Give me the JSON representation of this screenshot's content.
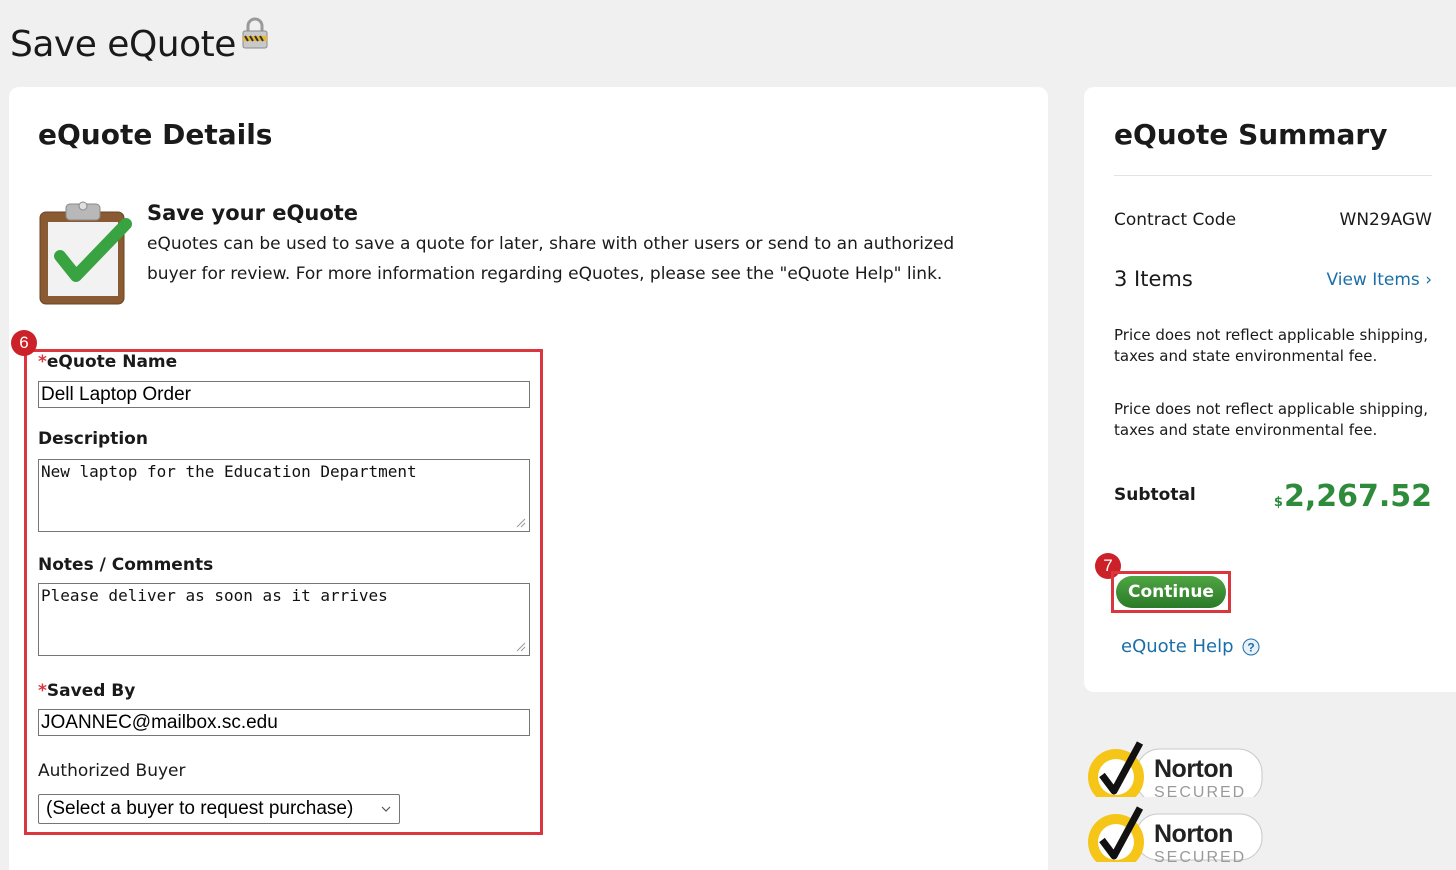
{
  "page": {
    "title": "Save eQuote"
  },
  "details": {
    "title": "eQuote Details",
    "intro_heading": "Save your eQuote",
    "intro_text": "eQuotes can be used to save a quote for later, share with other users or send to an authorized buyer for review. For more information regarding eQuotes, please see the \"eQuote Help\" link.",
    "step_badge": "6",
    "required_mark": "*",
    "name_label": "eQuote Name",
    "name_value": "Dell Laptop Order",
    "description_label": "Description",
    "description_value": "New laptop for the Education Department",
    "notes_label": "Notes / Comments",
    "notes_value": "Please deliver as soon as it arrives",
    "saved_by_label": "Saved By",
    "saved_by_value": "JOANNEC@mailbox.sc.edu",
    "buyer_label": "Authorized Buyer",
    "buyer_selected": "(Select a buyer to request purchase)"
  },
  "summary": {
    "title": "eQuote Summary",
    "contract_label": "Contract Code",
    "contract_value": "WN29AGW",
    "items_count": "3 Items",
    "view_items": "View Items ›",
    "disclaimer_1": "Price does not reflect applicable shipping, taxes and state environmental fee.",
    "disclaimer_2": "Price does not reflect applicable shipping, taxes and state environmental fee.",
    "subtotal_label": "Subtotal",
    "subtotal_currency": "$",
    "subtotal_value": "2,267.52",
    "step_badge": "7",
    "continue_label": "Continue",
    "help_label": "eQuote Help"
  },
  "badges": {
    "norton_1": "Norton SECURED",
    "norton_2": "Norton SECURED"
  },
  "colors": {
    "accent_red": "#d9363e",
    "link_blue": "#1a6fa8",
    "price_green": "#2e8b3c",
    "button_green": "#2b7a28"
  }
}
